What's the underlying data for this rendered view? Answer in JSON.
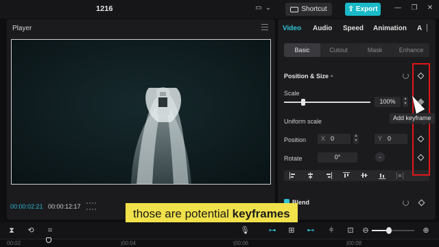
{
  "topbar": {
    "project_name": "1216",
    "shortcut_label": "Shortcut",
    "export_label": "Export",
    "icons": [
      "layout-icon",
      "keyboard-icon",
      "export-icon",
      "minimize-icon",
      "restore-icon",
      "close-icon"
    ]
  },
  "player": {
    "title": "Player",
    "current_time": "00:00:02:21",
    "total_time": "00:00:12:17"
  },
  "inspector": {
    "tabs": [
      {
        "label": "Video",
        "active": true
      },
      {
        "label": "Audio",
        "active": false
      },
      {
        "label": "Speed",
        "active": false
      },
      {
        "label": "Animation",
        "active": false
      },
      {
        "label": "A",
        "active": false
      }
    ],
    "subtabs": [
      {
        "label": "Basic",
        "active": true
      },
      {
        "label": "Cutout",
        "active": false
      },
      {
        "label": "Mask",
        "active": false
      },
      {
        "label": "Enhance",
        "active": false
      }
    ],
    "position_size": {
      "title": "Position & Size",
      "scale_label": "Scale",
      "scale_value": "100%",
      "scale_level": 0.22,
      "uniform_scale_label": "Uniform scale",
      "position_label": "Position",
      "x_axis": "X",
      "x_value": "0",
      "y_axis": "Y",
      "y_value": "0",
      "rotate_label": "Rotate",
      "rotate_value": "0°",
      "rotate_reset": "-"
    },
    "keyframe_tooltip": "Add keyframe",
    "blend_title": "Blend"
  },
  "caption": {
    "prefix": "those are potential ",
    "emphasis": "keyframes"
  },
  "timeline": {
    "ruler_labels": [
      "00:02",
      "|00:04",
      "|00:06",
      "|00:08"
    ],
    "zoom_level": 0.4
  },
  "colors": {
    "accent": "#2fc4d6",
    "export": "#19b9c8",
    "highlight": "#e0161b",
    "caption_bg": "#f1e14a"
  }
}
